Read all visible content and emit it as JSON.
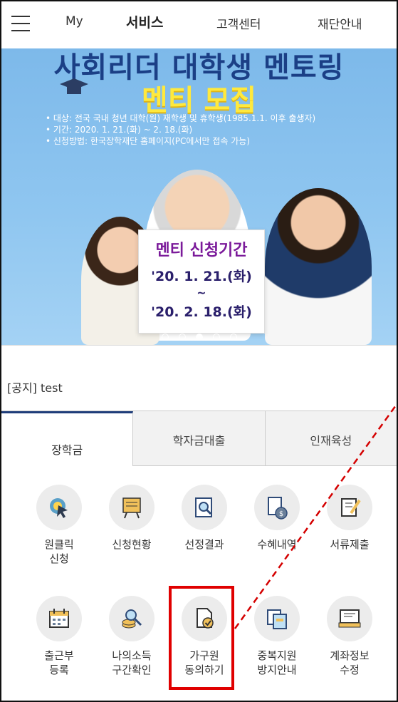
{
  "nav": {
    "items": [
      "My",
      "서비스",
      "고객센터",
      "재단안내"
    ],
    "active_index": 1
  },
  "banner": {
    "title": "사회리더 대학생 멘토링",
    "subtitle": "멘티 모집",
    "info": [
      "• 대상: 전국 국내 청년 대학(원) 재학생 및 휴학생(1985.1.1. 이후 출생자)",
      "• 기간: 2020. 1. 21.(화) ~ 2. 18.(화)",
      "• 신청방법: 한국장학재단 홈페이지(PC에서만 접속 가능)"
    ],
    "sign_title": "멘티 신청기간",
    "sign_date_start": "'20. 1. 21.(화)",
    "sign_tilde": "~",
    "sign_date_end": "'20. 2. 18.(화)",
    "slide_count": 6,
    "active_slide": 2
  },
  "notice": {
    "text": "[공지] test"
  },
  "tabs": [
    {
      "label": "장학금",
      "active": true
    },
    {
      "label": "학자금대출",
      "active": false
    },
    {
      "label": "인재육성",
      "active": false
    }
  ],
  "services": {
    "row1": [
      {
        "label": "원클릭\n신청",
        "icon": "cursor-click-icon"
      },
      {
        "label": "신청현황",
        "icon": "presentation-board-icon"
      },
      {
        "label": "선정결과",
        "icon": "magnifier-document-icon"
      },
      {
        "label": "수혜내역",
        "icon": "money-bag-document-icon"
      },
      {
        "label": "서류제출",
        "icon": "scroll-pen-icon"
      }
    ],
    "row2": [
      {
        "label": "출근부\n등록",
        "icon": "calendar-icon"
      },
      {
        "label": "나의소득\n구간확인",
        "icon": "coins-magnifier-icon"
      },
      {
        "label": "가구원\n동의하기",
        "icon": "document-check-icon"
      },
      {
        "label": "중복지원\n방지안내",
        "icon": "duplicate-documents-icon"
      },
      {
        "label": "계좌정보\n수정",
        "icon": "bank-card-icon"
      }
    ]
  },
  "colors": {
    "accent": "#1f3d7a",
    "highlight": "#e00000",
    "banner_sky": "#8fc6f0",
    "icon_bg": "#ececec"
  }
}
